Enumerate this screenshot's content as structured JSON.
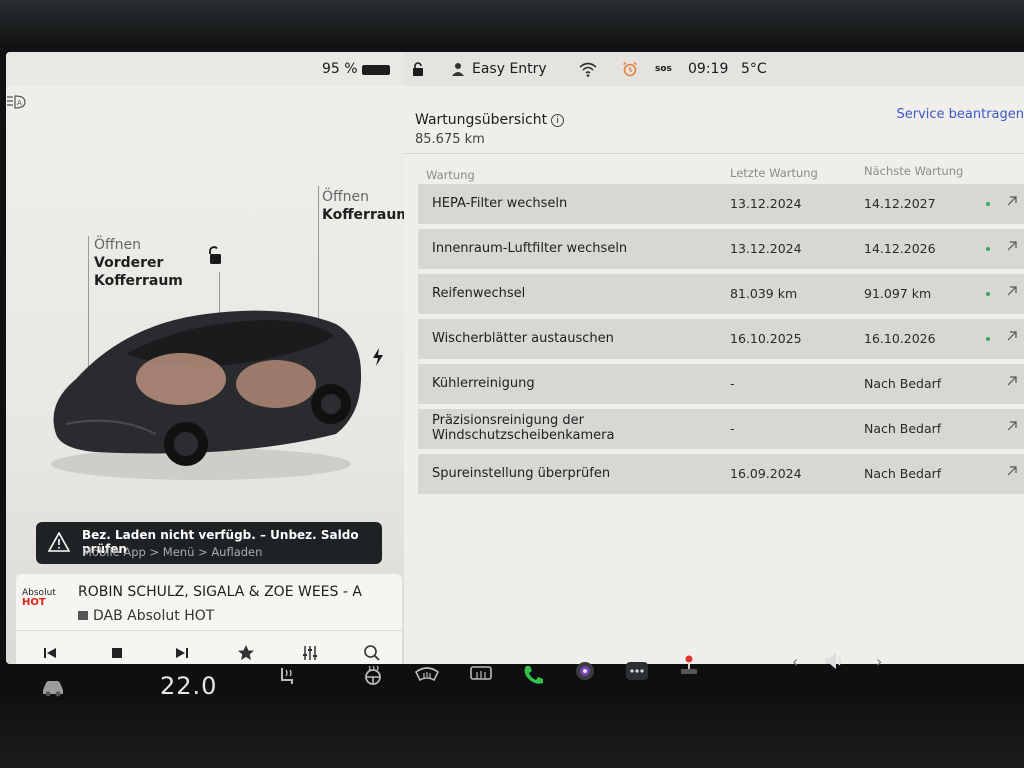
{
  "status": {
    "battery": "95 %",
    "profile": "Easy Entry",
    "sos": "sos",
    "time": "09:19",
    "temperature": "5°C"
  },
  "car": {
    "open_front_verb": "Öffnen",
    "open_front_line1": "Vorderer",
    "open_front_line2": "Kofferraum",
    "open_rear_verb": "Öffnen",
    "open_rear_noun": "Kofferraum"
  },
  "alert": {
    "title": "Bez. Laden nicht verfügb. – Unbez. Saldo prüfen",
    "subtitle": "Mobile App > Menü > Aufladen"
  },
  "media": {
    "logo_line1": "Absolut",
    "logo_line2": "HOT",
    "title": "ROBIN SCHULZ, SIGALA & ZOE WEES - A",
    "station": "DAB Absolut HOT"
  },
  "service": {
    "title": "Wartungsübersicht",
    "info_glyph": "i",
    "odometer": "85.675 km",
    "request_link": "Service beantragen",
    "columns": [
      "Wartung",
      "Letzte Wartung",
      "Nächste Wartung"
    ],
    "rows": [
      {
        "task": "HEPA-Filter wechseln",
        "last": "13.12.2024",
        "next": "14.12.2027",
        "status": "ok"
      },
      {
        "task": "Innenraum-Luftfilter wechseln",
        "last": "13.12.2024",
        "next": "14.12.2026",
        "status": "ok"
      },
      {
        "task": "Reifenwechsel",
        "last": "81.039 km",
        "next": "91.097 km",
        "status": "ok"
      },
      {
        "task": "Wischerblätter austauschen",
        "last": "16.10.2025",
        "next": "16.10.2026",
        "status": "ok"
      },
      {
        "task": "Kühlerreinigung",
        "last": "-",
        "next": "Nach Bedarf",
        "status": "none"
      },
      {
        "task_line1": "Präzisionsreinigung der",
        "task_line2": "Windschutzscheibenkamera",
        "last": "-",
        "next": "Nach Bedarf",
        "status": "none"
      },
      {
        "task": "Spureinstellung überprüfen",
        "last": "16.09.2024",
        "next": "Nach Bedarf",
        "status": "none"
      }
    ]
  },
  "dock": {
    "cabin_temp": "22.0"
  },
  "icons": [
    "headlight-icon",
    "lock-icon",
    "bolt-icon",
    "warning-icon",
    "prev-icon",
    "stop-icon",
    "next-icon",
    "star-icon",
    "equalizer-icon",
    "search-icon",
    "car-icon",
    "seat-heat-icon",
    "steering-heat-icon",
    "defrost-front-icon",
    "defrost-rear-icon",
    "phone-icon",
    "camera-icon",
    "more-icon",
    "joystick-icon",
    "volume-icon"
  ],
  "colors": {
    "accent_link": "#3b59c4",
    "status_ok": "#3aa856",
    "phone": "#35c24a",
    "alarm": "#e6823a"
  }
}
